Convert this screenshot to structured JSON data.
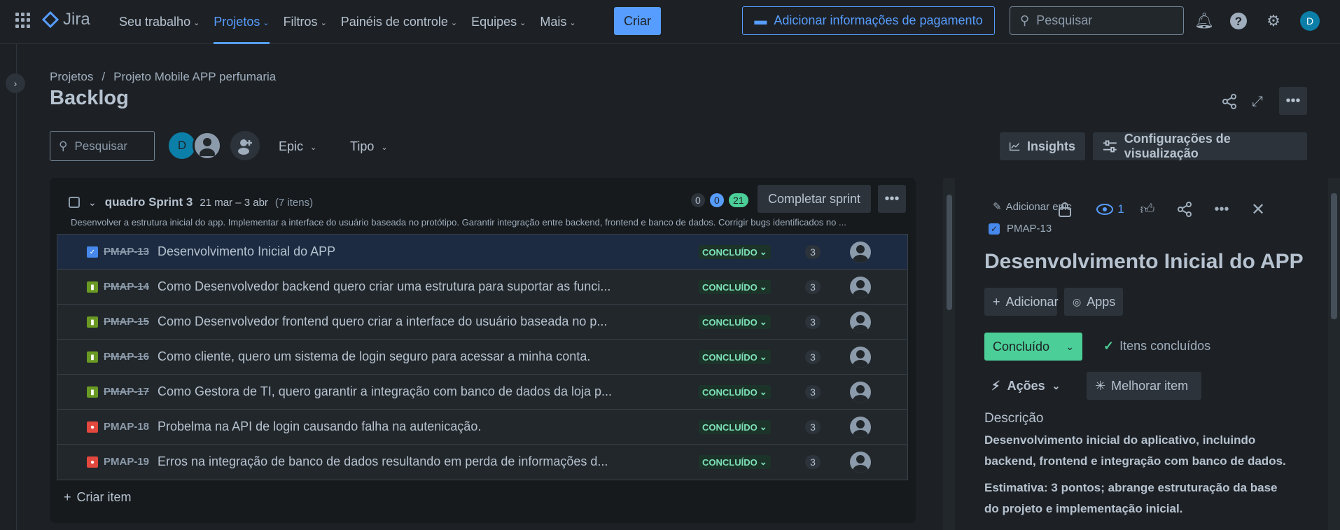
{
  "topnav": {
    "logo_text": "Jira",
    "items": [
      {
        "label": "Seu trabalho"
      },
      {
        "label": "Projetos"
      },
      {
        "label": "Filtros"
      },
      {
        "label": "Painéis de controle"
      },
      {
        "label": "Equipes"
      },
      {
        "label": "Mais"
      }
    ],
    "active_item": "Projetos",
    "create_label": "Criar",
    "payment_label": "Adicionar informações de pagamento",
    "search_placeholder": "Pesquisar",
    "avatar_initial": "D"
  },
  "breadcrumb": {
    "root": "Projetos",
    "separator": "/",
    "project": "Projeto Mobile APP perfumaria"
  },
  "page_title": "Backlog",
  "toolbar": {
    "search_placeholder": "Pesquisar",
    "avatar_initial": "D",
    "filter_epic": "Epic",
    "filter_type": "Tipo",
    "insights_label": "Insights",
    "view_settings_label": "Configurações de visualização"
  },
  "sprint": {
    "name": "quadro Sprint 3",
    "dates": "21 mar – 3 abr",
    "count": "(7 itens)",
    "todo_count": "0",
    "inprogress_count": "0",
    "done_count": "21",
    "complete_label": "Completar sprint",
    "goal": "Desenvolver a estrutura inicial do app. Implementar a interface do usuário baseada no protótipo. Garantir integração entre backend, frontend e banco de dados. Corrigir bugs identificados no ...",
    "issues": [
      {
        "key": "PMAP-13",
        "summary": "Desenvolvimento Inicial do APP",
        "status": "CONCLUÍDO",
        "points": "3",
        "type": "task"
      },
      {
        "key": "PMAP-14",
        "summary": "Como Desenvolvedor backend quero criar uma estrutura para suportar as funci...",
        "status": "CONCLUÍDO",
        "points": "3",
        "type": "story"
      },
      {
        "key": "PMAP-15",
        "summary": "Como Desenvolvedor frontend quero criar a interface do usuário baseada no p...",
        "status": "CONCLUÍDO",
        "points": "3",
        "type": "story"
      },
      {
        "key": "PMAP-16",
        "summary": "Como cliente, quero um sistema de login seguro para acessar a minha conta.",
        "status": "CONCLUÍDO",
        "points": "3",
        "type": "story"
      },
      {
        "key": "PMAP-17",
        "summary": "Como Gestora de TI, quero garantir a integração com banco de dados da loja p...",
        "status": "CONCLUÍDO",
        "points": "3",
        "type": "story"
      },
      {
        "key": "PMAP-18",
        "summary": "Probelma na API de login causando falha na autenicação.",
        "status": "CONCLUÍDO",
        "points": "3",
        "type": "bug"
      },
      {
        "key": "PMAP-19",
        "summary": "Erros na integração de banco de dados resultando em perda de informações d...",
        "status": "CONCLUÍDO",
        "points": "3",
        "type": "bug"
      }
    ],
    "create_item_label": "Criar item"
  },
  "panel": {
    "add_epic_label": "Adicionar epic",
    "issue_key": "PMAP-13",
    "watch_count": "1",
    "title": "Desenvolvimento Inicial do APP",
    "add_label": "Adicionar",
    "apps_label": "Apps",
    "status_label": "Concluído",
    "done_items_label": "Itens concluídos",
    "actions_label": "Ações",
    "improve_label": "Melhorar item",
    "description_heading": "Descrição",
    "description_p1": "Desenvolvimento inicial do aplicativo, incluindo backend, frontend e integração com banco de dados.",
    "description_p2": "Estimativa: 3 pontos; abrange estruturação da base do projeto e implementação inicial."
  },
  "colors": {
    "accent": "#579dff",
    "done_green": "#4bce97",
    "story": "#6a9a23",
    "bug": "#e2483d",
    "task": "#4688ec"
  }
}
